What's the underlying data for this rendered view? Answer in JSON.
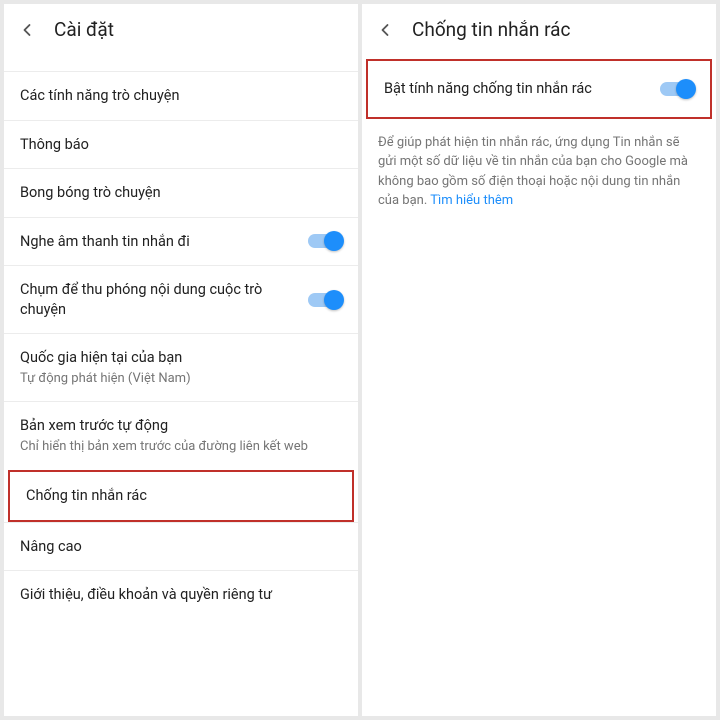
{
  "left": {
    "title": "Cài đặt",
    "items": [
      {
        "title": "Các tính năng trò chuyện",
        "sub": null,
        "toggle": false
      },
      {
        "title": "Thông báo",
        "sub": null,
        "toggle": false
      },
      {
        "title": "Bong bóng trò chuyện",
        "sub": null,
        "toggle": false
      },
      {
        "title": "Nghe âm thanh tin nhắn đi",
        "sub": null,
        "toggle": true
      },
      {
        "title": "Chụm để thu phóng nội dung cuộc trò chuyện",
        "sub": null,
        "toggle": true
      },
      {
        "title": "Quốc gia hiện tại của bạn",
        "sub": "Tự động phát hiện (Việt Nam)",
        "toggle": false
      },
      {
        "title": "Bản xem trước tự động",
        "sub": "Chỉ hiển thị bản xem trước của đường liên kết web",
        "toggle": false
      },
      {
        "title": "Chống tin nhắn rác",
        "sub": null,
        "toggle": false,
        "highlight": true
      },
      {
        "title": "Nâng cao",
        "sub": null,
        "toggle": false
      },
      {
        "title": "Giới thiệu, điều khoản và quyền riêng tư",
        "sub": null,
        "toggle": false
      }
    ]
  },
  "right": {
    "title": "Chống tin nhắn rác",
    "toggleLabel": "Bật tính năng chống tin nhắn rác",
    "description": "Để giúp phát hiện tin nhắn rác, ứng dụng Tin nhắn sẽ gửi một số dữ liệu về tin nhắn của bạn cho Google mà không bao gồm số điện thoại hoặc nội dung tin nhắn của bạn.",
    "link": "Tìm hiểu thêm"
  }
}
